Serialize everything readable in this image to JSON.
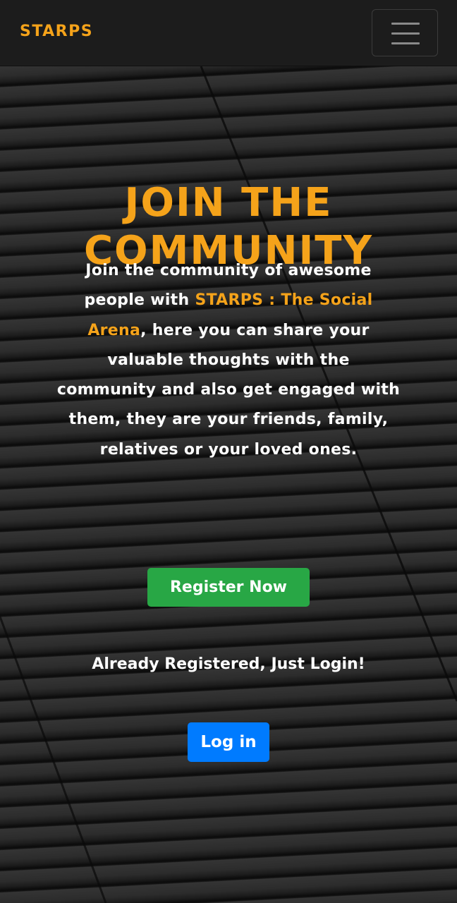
{
  "navbar": {
    "brand": "STARPS",
    "menu_icon": "hamburger-menu-icon"
  },
  "hero": {
    "title_line1": "JOIN THE",
    "title_line2": "COMMUNITY",
    "text_before": "Join the community of awesome people with ",
    "text_highlight": "STARPS : The Social Arena",
    "text_after": ", here you can share your valuable thoughts with the community and also get engaged with them, they are your friends, family, relatives or your loved ones.",
    "register_label": "Register Now",
    "login_prompt": "Already Registered, Just Login!",
    "login_label": "Log in"
  },
  "colors": {
    "accent": "#f5a31a",
    "register_button": "#28a745",
    "login_button": "#007bff",
    "navbar_bg": "#1c1c1c"
  }
}
